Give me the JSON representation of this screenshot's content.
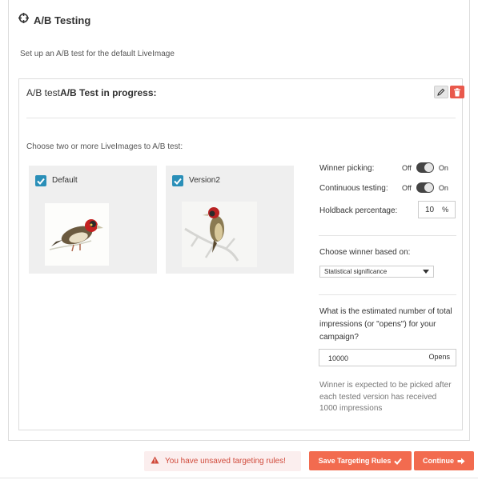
{
  "header": {
    "title": "A/B Testing",
    "icon": "crosshair-icon"
  },
  "subtitle": "Set up an A/B test for the default LiveImage",
  "test": {
    "label_prefix": "A/B test",
    "label_status": "A/B Test in progress:",
    "edit_icon": "pencil-icon",
    "delete_icon": "trash-icon"
  },
  "choose_label": "Choose two or more LiveImages to A/B test:",
  "variants": [
    {
      "name": "Default",
      "checked": true,
      "image": "bird-thumbnail"
    },
    {
      "name": "Version2",
      "checked": true,
      "image": "bird-on-branch-thumbnail"
    }
  ],
  "options": {
    "winner_picking": {
      "label": "Winner picking:",
      "off": "Off",
      "on": "On"
    },
    "continuous_testing": {
      "label": "Continuous testing:",
      "off": "Off",
      "on": "On"
    },
    "holdback": {
      "label": "Holdback percentage:",
      "value": "10",
      "unit": "%"
    }
  },
  "winner_basis": {
    "label": "Choose winner based on:",
    "selected": "Statistical significance"
  },
  "impressions": {
    "question": "What is the estimated number of total impressions (or \"opens\") for your campaign?",
    "value": "10000",
    "unit": "Opens",
    "note": "Winner is expected to be picked after each tested version has received 1000 impressions"
  },
  "footer": {
    "warning": "You have unsaved targeting rules!",
    "save_label": "Save Targeting Rules",
    "continue_label": "Continue"
  },
  "colors": {
    "accent": "#f26b4f",
    "checkbox": "#2a8fb8",
    "danger": "#e9594c"
  }
}
